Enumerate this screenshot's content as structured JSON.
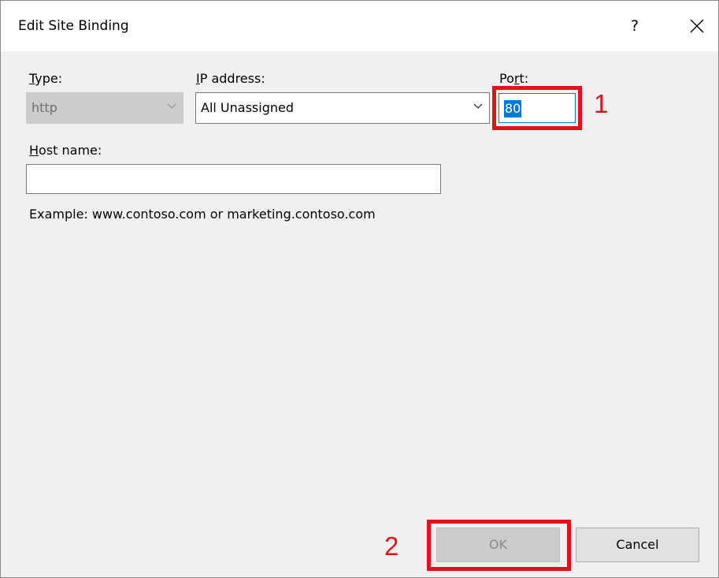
{
  "window": {
    "title": "Edit Site Binding",
    "help_glyph": "?"
  },
  "fields": {
    "type": {
      "label_first": "T",
      "label_rest": "ype:",
      "value": "http"
    },
    "ip": {
      "label_first": "I",
      "label_rest": "P address:",
      "value": "All Unassigned"
    },
    "port": {
      "label_pre": "Po",
      "label_underline": "r",
      "label_post": "t:",
      "value": "80"
    },
    "host": {
      "label_first": "H",
      "label_rest": "ost name:",
      "value": ""
    },
    "example": "Example: www.contoso.com or marketing.contoso.com"
  },
  "buttons": {
    "ok": "OK",
    "cancel": "Cancel"
  },
  "annotations": {
    "step1": "1",
    "step2": "2",
    "color": "#e0131b"
  }
}
